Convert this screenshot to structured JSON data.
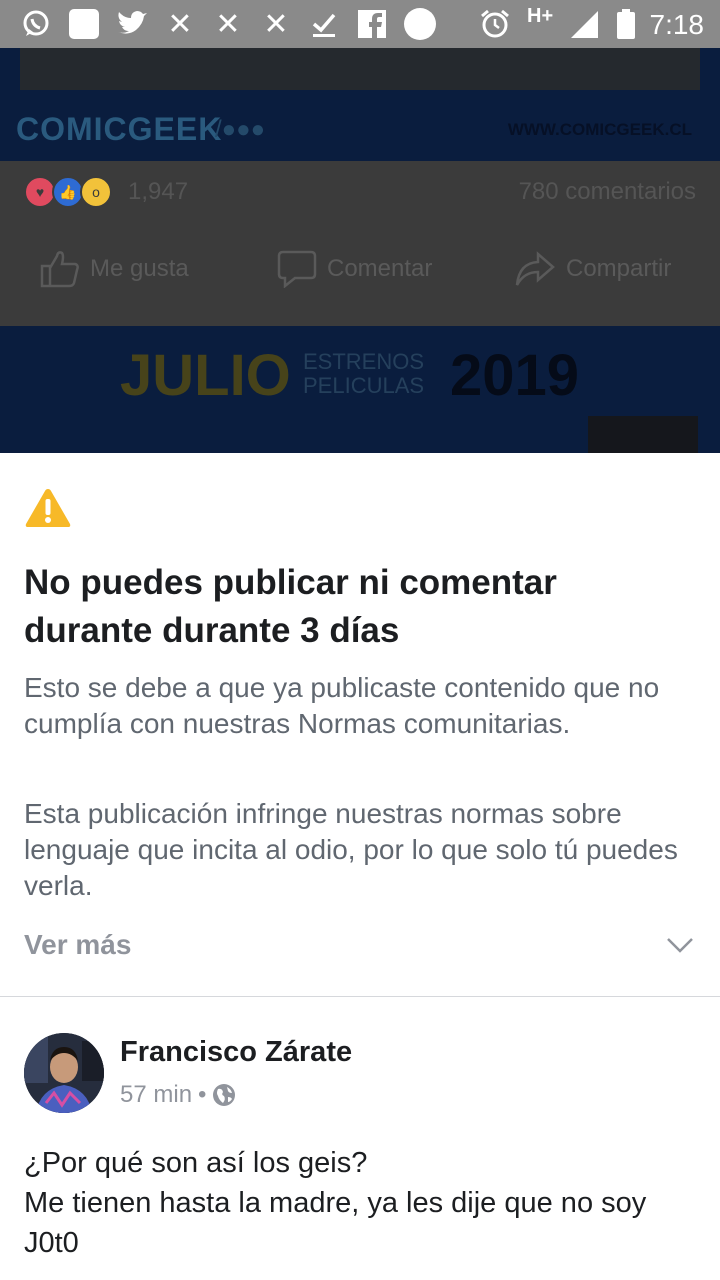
{
  "status_bar": {
    "time": "7:18",
    "network": "H+",
    "icons": [
      "whatsapp-icon",
      "white-square-icon",
      "twitter-icon",
      "close-icon",
      "close-icon",
      "close-icon",
      "download-done-icon",
      "facebook-icon",
      "circle-icon",
      "alarm-icon",
      "signal-icon",
      "battery-icon"
    ]
  },
  "background_post": {
    "logo": "COMICGEEK",
    "website": "WWW.COMICGEEK.CL",
    "reaction_count": "1,947",
    "comments_count": "780 comentarios",
    "actions": {
      "like": "Me gusta",
      "comment": "Comentar",
      "share": "Compartir"
    },
    "banner": {
      "month": "JULIO",
      "subtitle_line1": "ESTRENOS",
      "subtitle_line2": "PELICULAS",
      "year": "2019"
    }
  },
  "sheet": {
    "title": "No puedes publicar ni comentar durante durante 3 días",
    "paragraph1": "Esto se debe a que ya publicaste contenido que no cumplía con nuestras Normas comunitarias.",
    "paragraph2": "Esta publicación infringe nuestras normas sobre lenguaje que incita al odio, por lo que solo tú puedes verla.",
    "see_more": "Ver más"
  },
  "post": {
    "author": "Francisco Zárate",
    "time": "57 min",
    "separator": "•",
    "text_line1": "¿Por qué son así los geis?",
    "text_line2": "Me tienen hasta la madre, ya les dije que no soy J0t0"
  },
  "colors": {
    "status_bar": "#8a8a8a",
    "warning": "#f7b928",
    "title": "#1c1e21",
    "body_text": "#606770",
    "muted": "#90949c"
  }
}
